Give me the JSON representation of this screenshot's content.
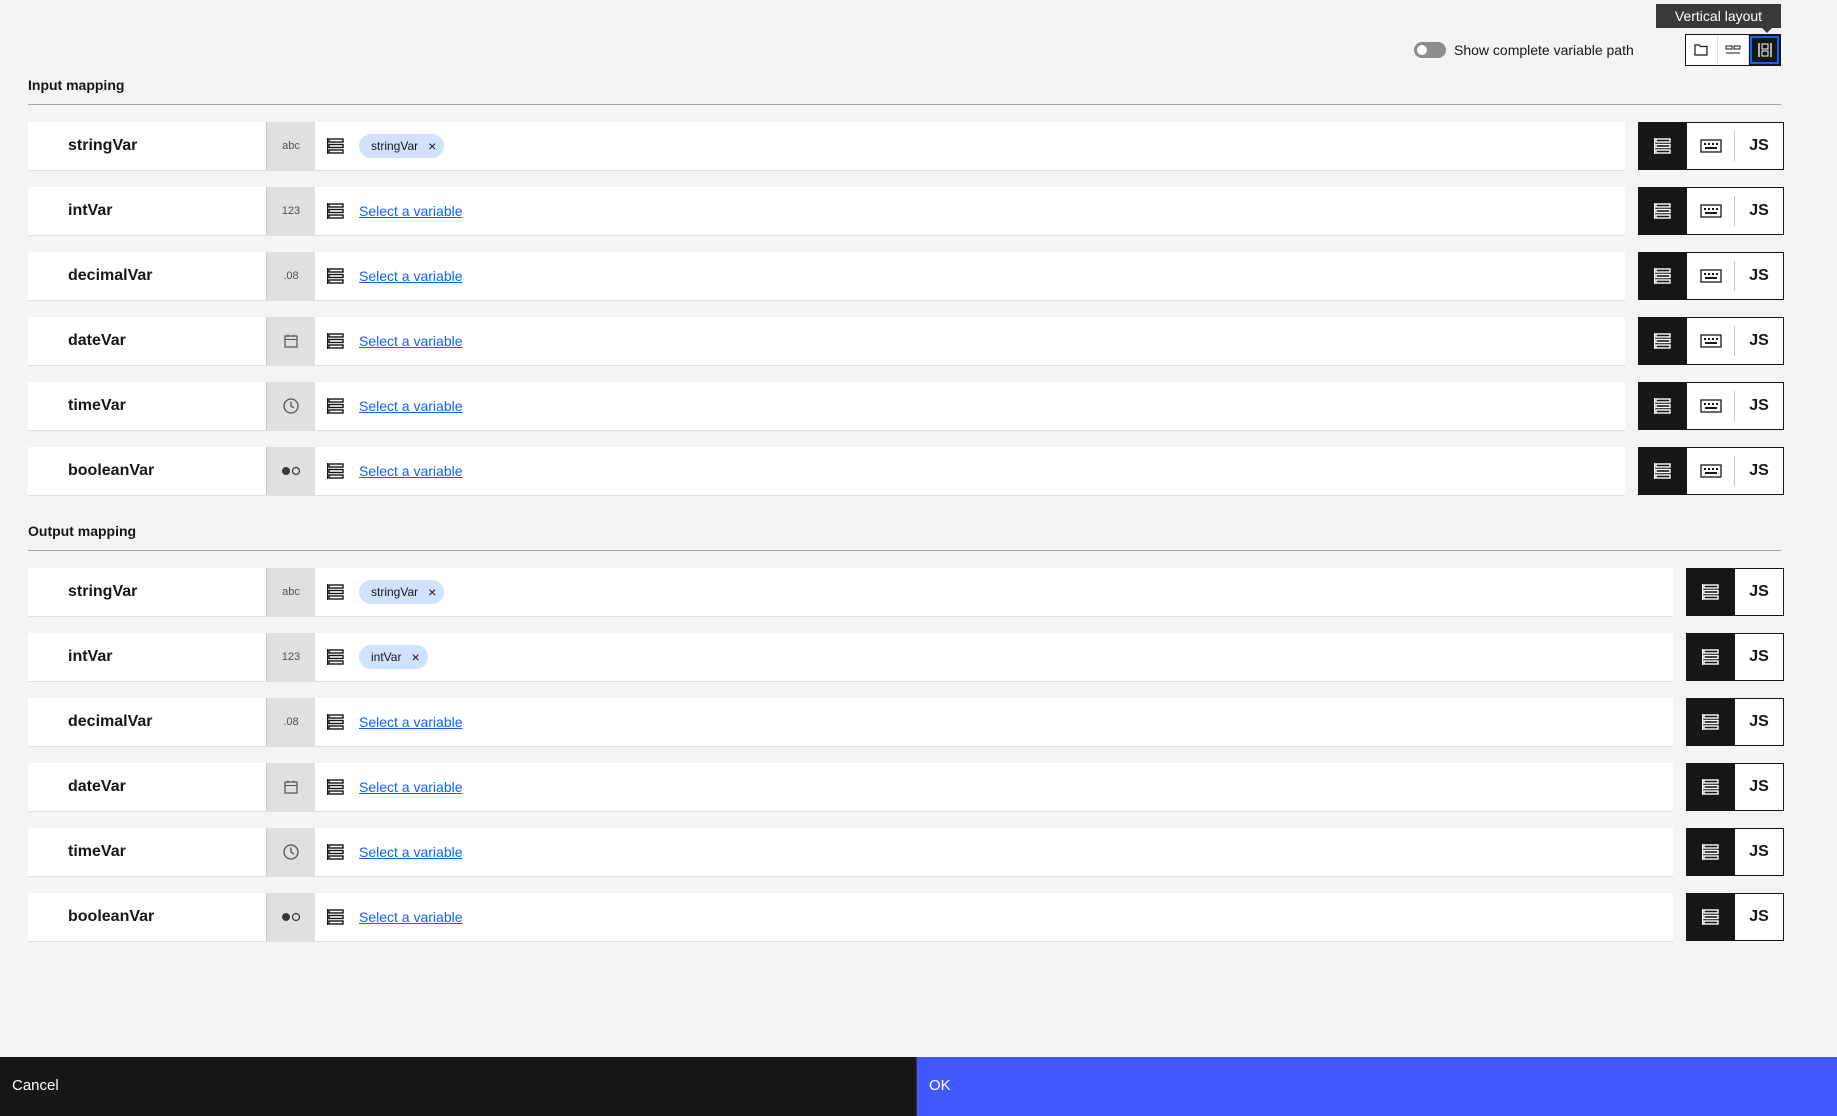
{
  "header": {
    "tooltip": "Vertical layout",
    "toggle_label": "Show complete variable path",
    "layout_icons": [
      "folder-icon",
      "horizontal-layout-icon",
      "vertical-layout-icon"
    ]
  },
  "input": {
    "title": "Input mapping",
    "rows": [
      {
        "name": "stringVar",
        "type": "abc",
        "tag": "stringVar",
        "link": ""
      },
      {
        "name": "intVar",
        "type": "123",
        "tag": "",
        "link": "Select a variable"
      },
      {
        "name": "decimalVar",
        "type": ".08",
        "tag": "",
        "link": "Select a variable"
      },
      {
        "name": "dateVar",
        "type": "calendar-icon",
        "tag": "",
        "link": "Select a variable"
      },
      {
        "name": "timeVar",
        "type": "clock-icon",
        "tag": "",
        "link": "Select a variable"
      },
      {
        "name": "booleanVar",
        "type": "toggle-icon",
        "tag": "",
        "link": "Select a variable"
      }
    ],
    "mode_labels": {
      "js": "JS"
    }
  },
  "output": {
    "title": "Output mapping",
    "rows": [
      {
        "name": "stringVar",
        "type": "abc",
        "tag": "stringVar",
        "link": ""
      },
      {
        "name": "intVar",
        "type": "123",
        "tag": "intVar",
        "link": ""
      },
      {
        "name": "decimalVar",
        "type": ".08",
        "tag": "",
        "link": "Select a variable"
      },
      {
        "name": "dateVar",
        "type": "calendar-icon",
        "tag": "",
        "link": "Select a variable"
      },
      {
        "name": "timeVar",
        "type": "clock-icon",
        "tag": "",
        "link": "Select a variable"
      },
      {
        "name": "booleanVar",
        "type": "toggle-icon",
        "tag": "",
        "link": "Select a variable"
      }
    ],
    "mode_labels": {
      "js": "JS"
    }
  },
  "footer": {
    "cancel": "Cancel",
    "ok": "OK"
  },
  "colors": {
    "primary": "#4258ff",
    "dark": "#161616",
    "tag": "#d0e2ff",
    "link": "#0f62fe"
  }
}
